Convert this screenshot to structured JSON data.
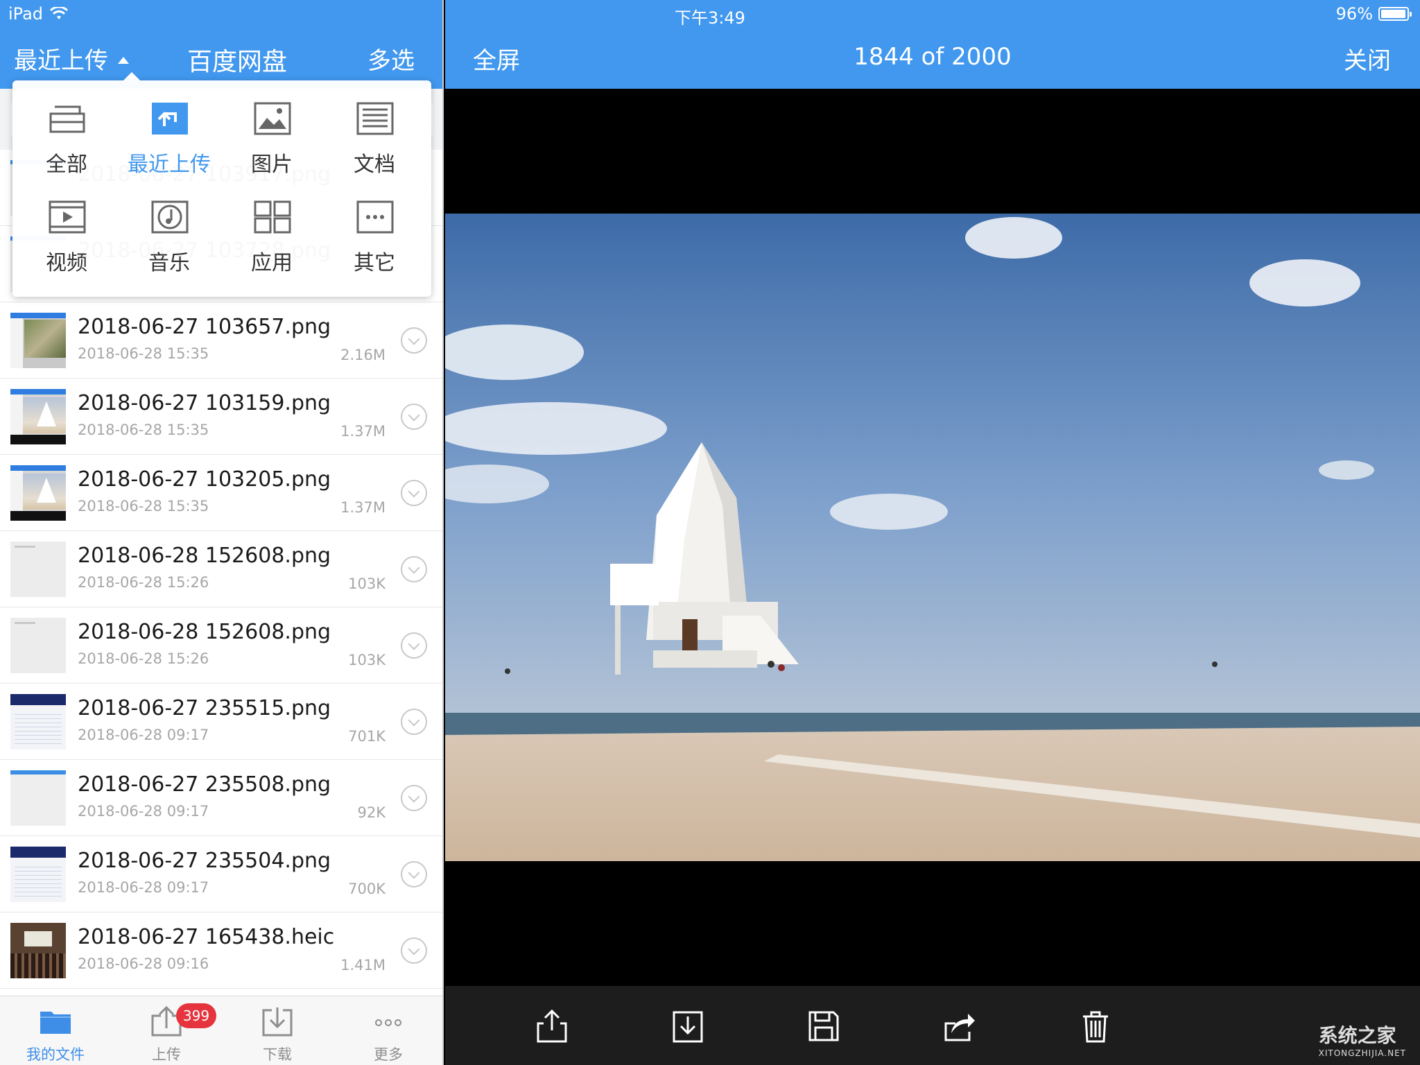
{
  "status_bar": {
    "device": "iPad",
    "time": "下午3:49",
    "battery_text": "96%",
    "battery_level": 0.96
  },
  "left_nav": {
    "filter_label": "最近上传",
    "title": "百度网盘",
    "multi_select": "多选"
  },
  "dropdown": {
    "items": [
      {
        "label": "全部",
        "icon": "all-files-icon",
        "active": false
      },
      {
        "label": "最近上传",
        "icon": "upload-icon",
        "active": true
      },
      {
        "label": "图片",
        "icon": "image-icon",
        "active": false
      },
      {
        "label": "文档",
        "icon": "document-icon",
        "active": false
      },
      {
        "label": "视频",
        "icon": "video-icon",
        "active": false
      },
      {
        "label": "音乐",
        "icon": "music-icon",
        "active": false
      },
      {
        "label": "应用",
        "icon": "apps-icon",
        "active": false
      },
      {
        "label": "其它",
        "icon": "more-icon",
        "active": false
      }
    ]
  },
  "files": [
    {
      "name": "2018-06-27 103917.png",
      "date": "",
      "size": "",
      "thumb": "white-hdr",
      "hidden_under_dropdown": true
    },
    {
      "name": "2018-06-27 103728.png",
      "date": "",
      "size": "",
      "thumb": "white-hdr",
      "hidden_under_dropdown": true
    },
    {
      "name": "2018-06-27 103657.png",
      "date": "2018-06-28 15:35",
      "size": "2.16M",
      "thumb": "map"
    },
    {
      "name": "2018-06-27 103159.png",
      "date": "2018-06-28 15:35",
      "size": "1.37M",
      "thumb": "chapel"
    },
    {
      "name": "2018-06-27 103205.png",
      "date": "2018-06-28 15:35",
      "size": "1.37M",
      "thumb": "chapel"
    },
    {
      "name": "2018-06-28 152608.png",
      "date": "2018-06-28 15:26",
      "size": "103K",
      "thumb": "blank"
    },
    {
      "name": "2018-06-28 152608.png",
      "date": "2018-06-28 15:26",
      "size": "103K",
      "thumb": "blank"
    },
    {
      "name": "2018-06-27 235515.png",
      "date": "2018-06-28 09:17",
      "size": "701K",
      "thumb": "table"
    },
    {
      "name": "2018-06-27 235508.png",
      "date": "2018-06-28 09:17",
      "size": "92K",
      "thumb": "white-hdr"
    },
    {
      "name": "2018-06-27 235504.png",
      "date": "2018-06-28 09:17",
      "size": "700K",
      "thumb": "table"
    },
    {
      "name": "2018-06-27 165438.heic",
      "date": "2018-06-28 09:16",
      "size": "1.41M",
      "thumb": "photo"
    }
  ],
  "tabbar": {
    "items": [
      {
        "label": "我的文件",
        "icon": "folder-icon",
        "active": true
      },
      {
        "label": "上传",
        "icon": "upload-tab-icon",
        "active": false,
        "badge": "399"
      },
      {
        "label": "下载",
        "icon": "download-tab-icon",
        "active": false
      },
      {
        "label": "更多",
        "icon": "ellipsis-icon",
        "active": false
      }
    ]
  },
  "viewer": {
    "fullscreen_label": "全屏",
    "counter": "1844 of 2000",
    "close_label": "关闭",
    "toolbar": [
      "share-icon",
      "download-icon",
      "save-icon",
      "forward-icon",
      "trash-icon"
    ]
  },
  "watermark": {
    "text": "系统之家",
    "sub": "XITONGZHIJIA.NET"
  },
  "colors": {
    "accent": "#4198ee",
    "badge": "#e5343d",
    "toolbar_bg": "#1d1d1d"
  }
}
